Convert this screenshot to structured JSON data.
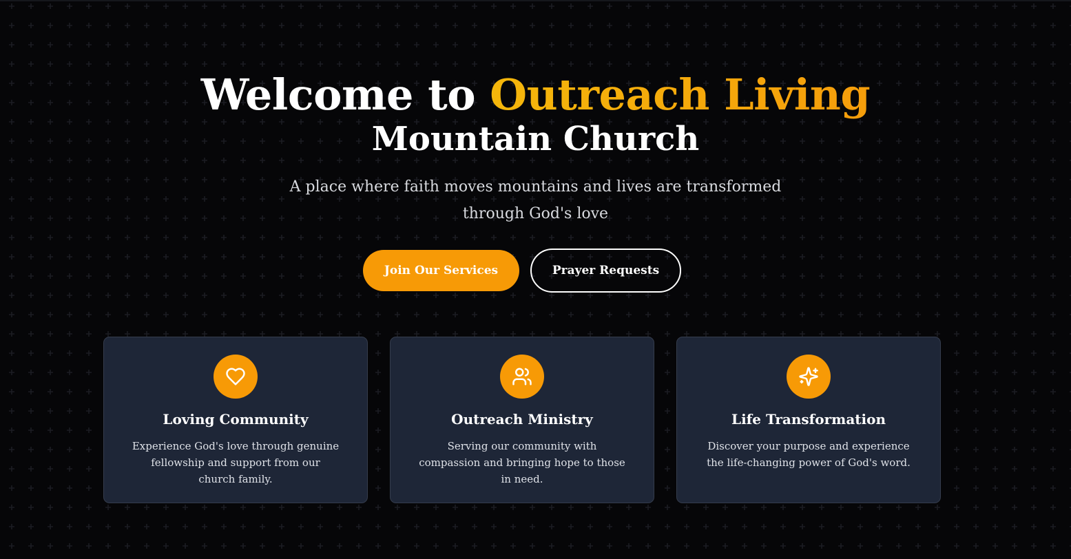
{
  "hero": {
    "title_prefix": "Welcome to ",
    "title_accent": "Outreach Living",
    "title_line2": "Mountain Church",
    "subtitle": "A place where faith moves mountains and lives are transformed through God's love"
  },
  "buttons": {
    "primary_label": "Join Our Services",
    "secondary_label": "Prayer Requests"
  },
  "cards": [
    {
      "icon": "heart-icon",
      "title": "Loving Community",
      "text": "Experience God's love through genuine fellowship and support from our church family."
    },
    {
      "icon": "users-icon",
      "title": "Outreach Ministry",
      "text": "Serving our community with compassion and bringing hope to those in need."
    },
    {
      "icon": "sparkles-icon",
      "title": "Life Transformation",
      "text": "Discover your purpose and experience the life-changing power of God's word."
    }
  ],
  "colors": {
    "background": "#060608",
    "accent": "#f79a06",
    "card_background": "#1e2637",
    "card_border": "#353d4d"
  }
}
